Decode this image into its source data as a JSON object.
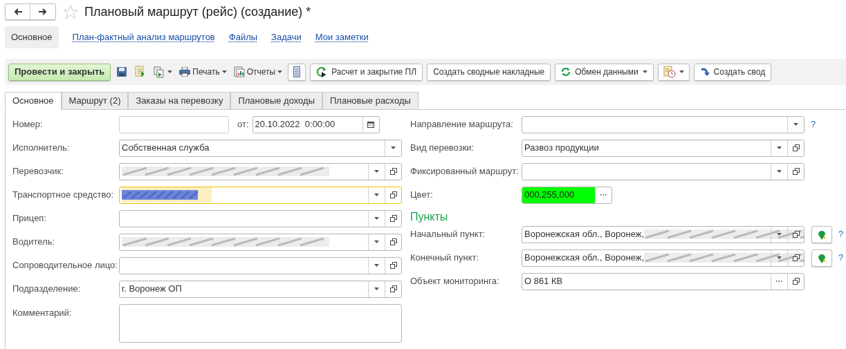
{
  "window": {
    "title": "Плановый маршрут (рейс) (создание) *"
  },
  "nav": [
    {
      "label": "Основное",
      "selected": true
    },
    {
      "label": "План-фактный анализ маршрутов",
      "selected": false
    },
    {
      "label": "Файлы",
      "selected": false
    },
    {
      "label": "Задачи",
      "selected": false
    },
    {
      "label": "Мои заметки",
      "selected": false
    }
  ],
  "toolbar": [
    {
      "kind": "primary",
      "label": "Провести и закрыть"
    },
    {
      "kind": "icon"
    },
    {
      "kind": "icon"
    },
    {
      "kind": "icon",
      "caret": true
    },
    {
      "kind": "menu",
      "label": "Печать",
      "caret": true
    },
    {
      "kind": "menu",
      "label": "Отчеты",
      "caret": true
    },
    {
      "kind": "iconbutton"
    },
    {
      "kind": "button",
      "label": "Расчет и закрытие ПЛ"
    },
    {
      "kind": "button",
      "label": "Создать сводные накладные"
    },
    {
      "kind": "button",
      "label": "Обмен данными",
      "caret": true
    },
    {
      "kind": "iconbutton",
      "caret": true
    },
    {
      "kind": "button",
      "label": "Создать свод"
    }
  ],
  "tabs": [
    {
      "label": "Основное",
      "selected": true
    },
    {
      "label": "Маршрут (2)",
      "selected": false
    },
    {
      "label": "Заказы на перевозку",
      "selected": false
    },
    {
      "label": "Плановые доходы",
      "selected": false
    },
    {
      "label": "Плановые расходы",
      "selected": false
    }
  ],
  "left_fields": [
    {
      "kind": "number",
      "label": "Номер:",
      "date_label": "от:",
      "date_value": "20.10.2022  0:00:00"
    },
    {
      "kind": "field",
      "label": "Исполнитель:",
      "value": "Собственная служба",
      "dropdown": true
    },
    {
      "kind": "field",
      "label": "Перевозчик:",
      "dropdown": true,
      "open": true,
      "redacted": true
    },
    {
      "kind": "field",
      "label": "Транспортное средство:",
      "dropdown": true,
      "open": true,
      "redacted": true,
      "focused": true
    },
    {
      "kind": "field",
      "label": "Прицеп:",
      "dropdown": true,
      "open": true
    },
    {
      "kind": "field",
      "label": "Водитель:",
      "dropdown": true,
      "open": true,
      "redacted": true
    },
    {
      "kind": "field",
      "label": "Сопроводительное лицо:",
      "dropdown": true,
      "open": true
    },
    {
      "kind": "field",
      "label": "Подразделение:",
      "value": "г. Воронеж ОП",
      "dropdown": true,
      "open": true
    },
    {
      "kind": "textarea",
      "label": "Комментарий:"
    }
  ],
  "right_fields": [
    {
      "kind": "field",
      "label": "Направление маршрута:",
      "dropdown": true,
      "help": "?"
    },
    {
      "kind": "field",
      "label": "Вид перевозки:",
      "value": "Развоз продукции",
      "dropdown": true,
      "open": true
    },
    {
      "kind": "field",
      "label": "Фиксированный маршрут:",
      "dropdown": true,
      "open": true
    },
    {
      "kind": "color",
      "label": "Цвет:",
      "value": "000,255,000",
      "color": "#00ff00"
    },
    {
      "kind": "heading",
      "label": "Пункты"
    },
    {
      "kind": "field",
      "label": "Начальный пункт:",
      "value": "Воронежская обл., Воронеж,",
      "dropdown": true,
      "open": true,
      "redacted": true,
      "map_button": true,
      "help": "?"
    },
    {
      "kind": "field",
      "label": "Конечный пункт:",
      "value": "Воронежская обл., Воронеж,",
      "dropdown": true,
      "open": true,
      "redacted": true,
      "map_button": true,
      "help": "?"
    },
    {
      "kind": "field",
      "label": "Объект мониторинга:",
      "value": "О 861 КВ",
      "ellipsis": true,
      "open": true
    }
  ]
}
